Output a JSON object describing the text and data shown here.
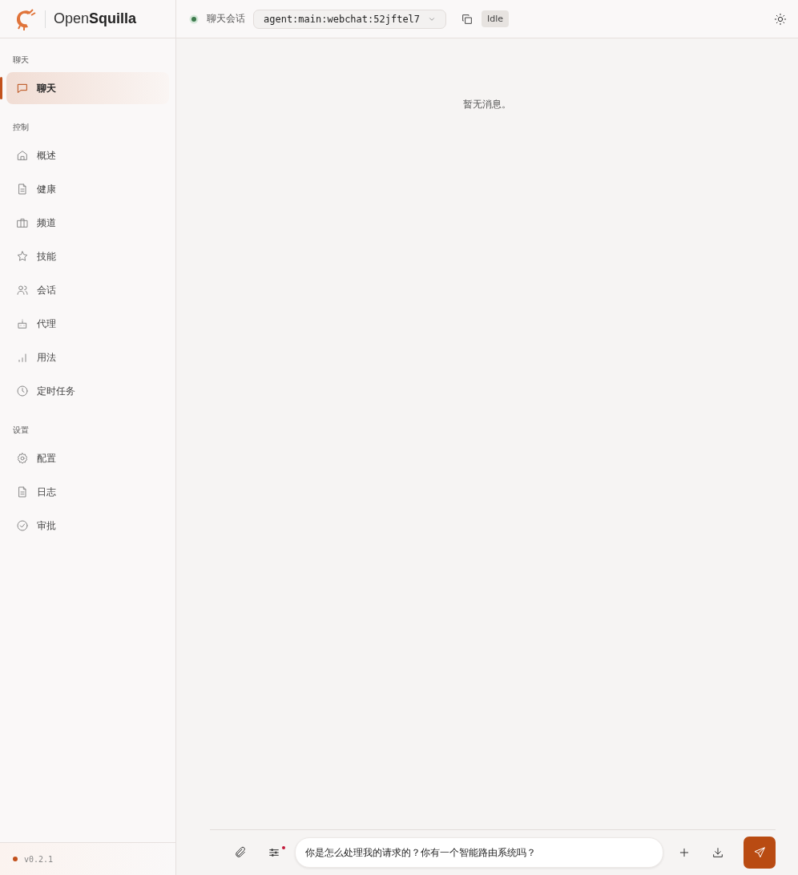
{
  "brand": {
    "light": "Open",
    "bold": "Squilla"
  },
  "topbar": {
    "status_online": true,
    "label": "聊天会话",
    "session": "agent:main:webchat:52jftel7",
    "state": "Idle"
  },
  "sidebar": {
    "sections": [
      {
        "title": "聊天",
        "items": [
          {
            "label": "聊天",
            "selected": true
          }
        ]
      },
      {
        "title": "控制",
        "items": [
          {
            "label": "概述",
            "selected": false
          },
          {
            "label": "健康",
            "selected": false
          },
          {
            "label": "频道",
            "selected": false
          },
          {
            "label": "技能",
            "selected": false
          },
          {
            "label": "会话",
            "selected": false
          },
          {
            "label": "代理",
            "selected": false
          },
          {
            "label": "用法",
            "selected": false
          },
          {
            "label": "定时任务",
            "selected": false
          }
        ]
      },
      {
        "title": "设置",
        "items": [
          {
            "label": "配置",
            "selected": false
          },
          {
            "label": "日志",
            "selected": false
          },
          {
            "label": "审批",
            "selected": false
          }
        ]
      }
    ],
    "version": "v0.2.1"
  },
  "chat": {
    "empty_text": "暂无消息。",
    "composer": {
      "value": "你是怎么处理我的请求的？你有一个智能路由系统吗？",
      "settings_changed": true
    }
  }
}
